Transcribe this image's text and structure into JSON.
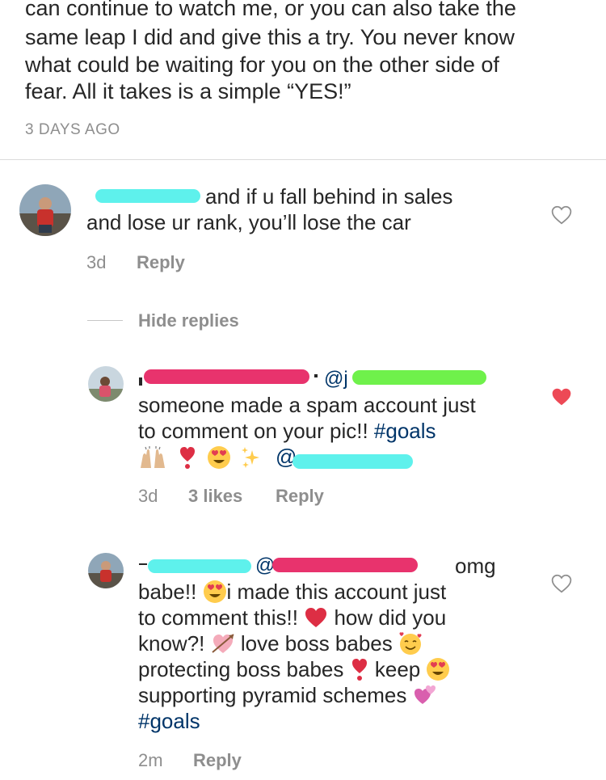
{
  "post": {
    "lines": [
      "can continue to watch me, or you can also take the",
      "same leap I did and give this a try. You never know",
      "what could be waiting for you on the other side of",
      "fear. All it takes is a simple “YES!”"
    ],
    "time_ago": "3 DAYS AGO"
  },
  "comment1": {
    "line1": "and if u fall behind in sales",
    "line2": "and lose ur rank, you’ll lose the car",
    "time": "3d",
    "reply": "Reply"
  },
  "hide_replies": "Hide replies",
  "reply1": {
    "mention": "@j",
    "line1": "someone made a spam account just",
    "line2_text": "to comment on your pic!! ",
    "hashtag": "#goals",
    "at": "@",
    "time": "3d",
    "likes": "3 likes",
    "reply": "Reply"
  },
  "reply2": {
    "mention": "@",
    "omg": "omg",
    "l2a": "babe!!",
    "l2b": "i made this account just",
    "l3a": "to comment this!!",
    "l3b": "how did you",
    "l4a": "know?!",
    "l4b": "love boss babes",
    "l5a": "protecting boss babes",
    "l5b": "keep",
    "l6": "supporting pyramid schemes",
    "hashtag": "#goals",
    "time": "2m",
    "reply": "Reply"
  },
  "colors": {
    "cyan_redaction": "#5ef1ec",
    "pink_redaction": "#e8336d",
    "green_redaction": "#6ff14b",
    "liked_heart": "#ed4956",
    "hashtag": "#003569"
  }
}
